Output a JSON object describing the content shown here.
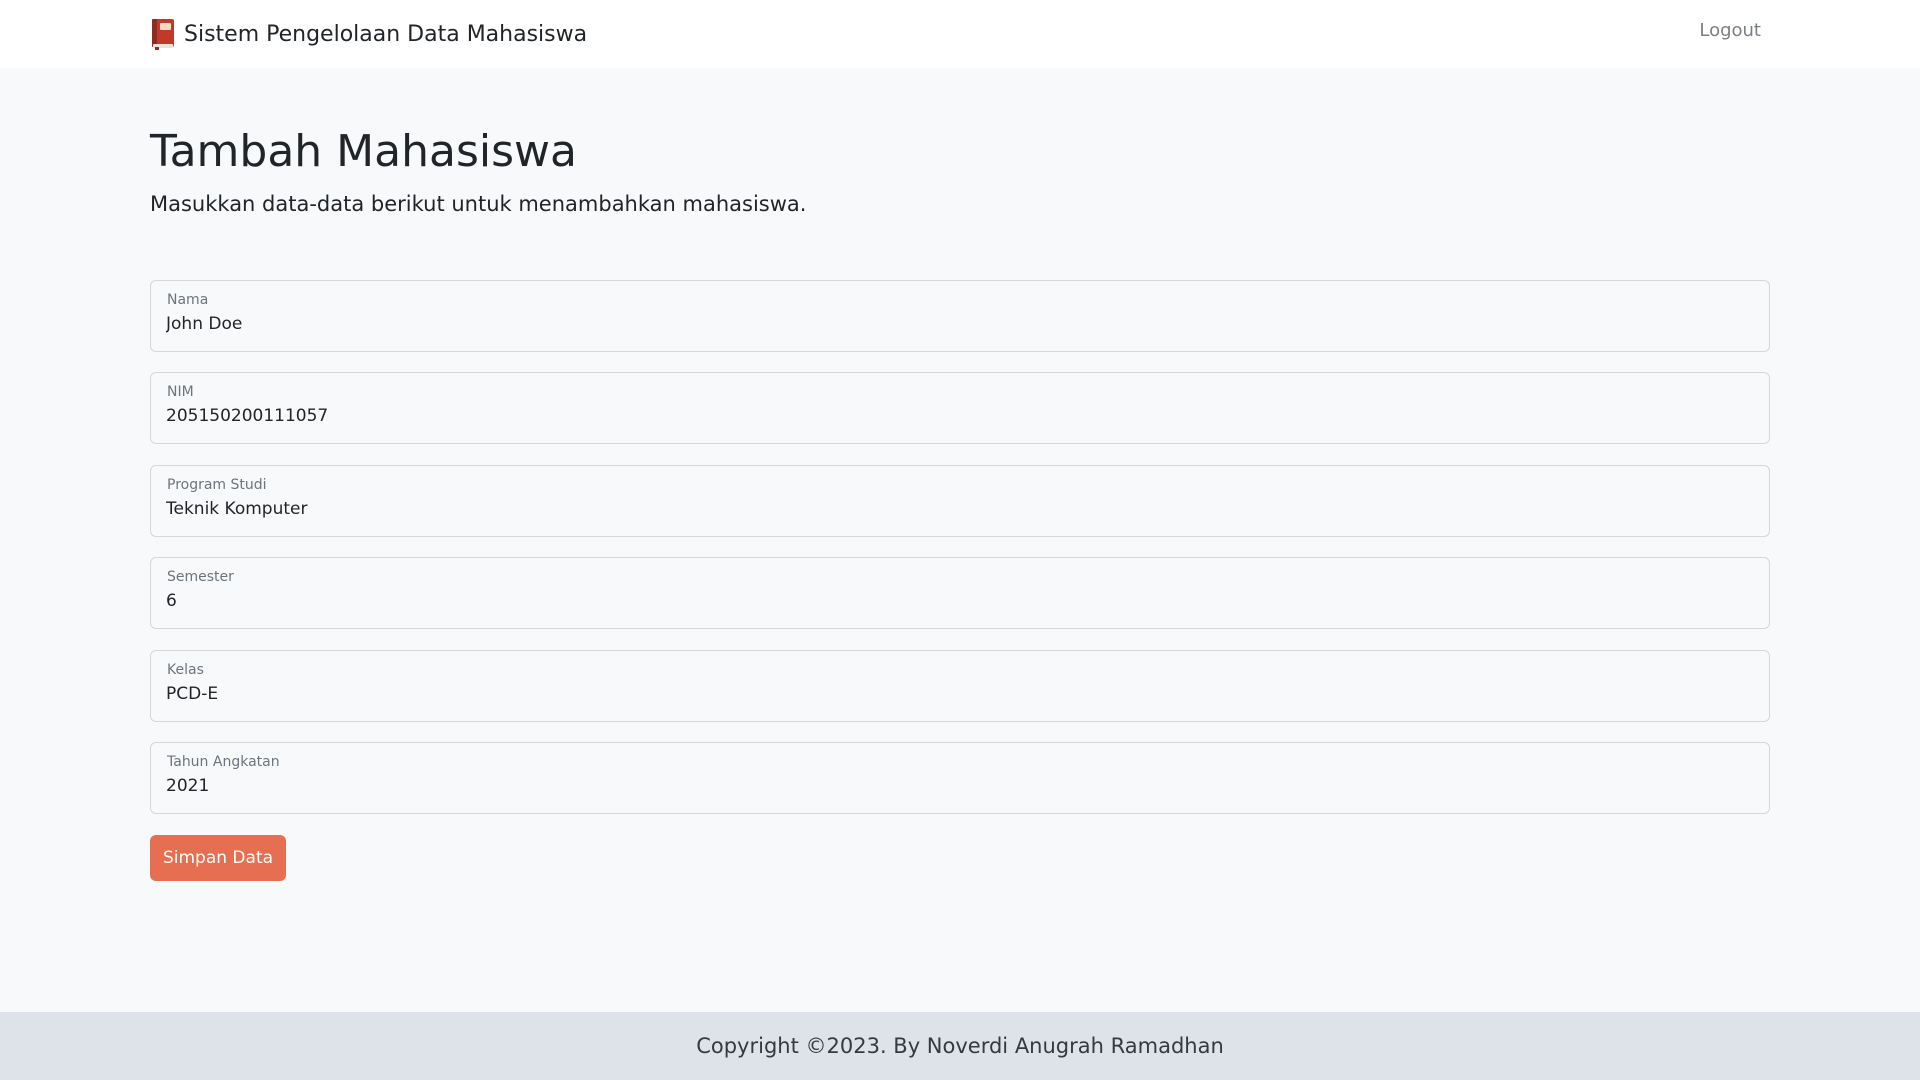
{
  "navbar": {
    "brand_icon": "book-icon",
    "brand_title": "Sistem Pengelolaan Data Mahasiswa",
    "logout_label": "Logout"
  },
  "page": {
    "title": "Tambah Mahasiswa",
    "subtitle": "Masukkan data-data berikut untuk menambahkan mahasiswa."
  },
  "form": {
    "fields": [
      {
        "label": "Nama",
        "value": "John Doe"
      },
      {
        "label": "NIM",
        "value": "205150200111057"
      },
      {
        "label": "Program Studi",
        "value": "Teknik Komputer"
      },
      {
        "label": "Semester",
        "value": "6"
      },
      {
        "label": "Kelas",
        "value": "PCD-E"
      },
      {
        "label": "Tahun Angkatan",
        "value": "2021"
      }
    ],
    "submit_label": "Simpan Data"
  },
  "footer": {
    "copyright": "Copyright ©2023. By Noverdi Anugrah Ramadhan"
  },
  "colors": {
    "accent": "#e76f51",
    "page_background": "#f8f9fa",
    "footer_background": "#dee2e9",
    "book_icon": "#c0392b"
  }
}
